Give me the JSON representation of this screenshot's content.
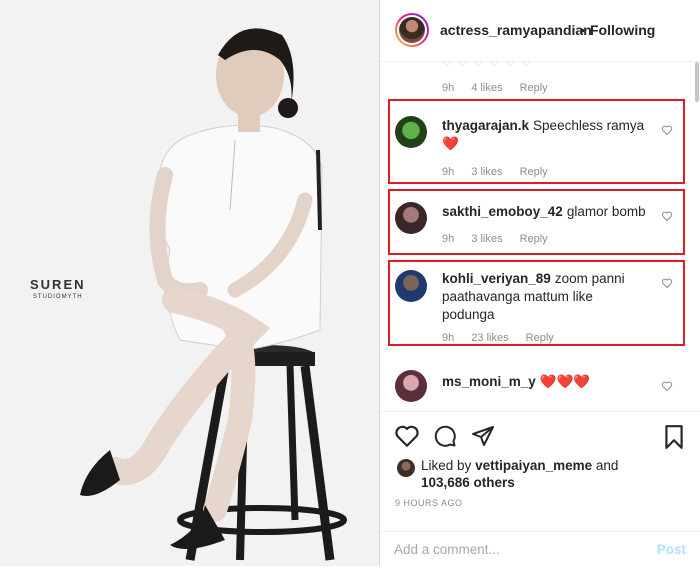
{
  "post": {
    "username": "actress_ramyapandian",
    "separator": "•",
    "follow_status": "Following"
  },
  "photo": {
    "watermark_line1": "SUREN",
    "watermark_line2": "STUDIOMYTH"
  },
  "comments": [
    {
      "user": "",
      "text": "",
      "time": "9h",
      "likes": "4 likes",
      "reply": "Reply",
      "highlighted": false
    },
    {
      "user": "thyagarajan.k",
      "text": "Speechless ramya ❤️",
      "time": "9h",
      "likes": "3 likes",
      "reply": "Reply",
      "highlighted": true
    },
    {
      "user": "sakthi_emoboy_42",
      "text": "glamor bomb",
      "time": "9h",
      "likes": "3 likes",
      "reply": "Reply",
      "highlighted": true
    },
    {
      "user": "kohli_veriyan_89",
      "text": "zoom panni paathavanga mattum like podunga",
      "time": "9h",
      "likes": "23 likes",
      "reply": "Reply",
      "highlighted": true
    },
    {
      "user": "ms_moni_m_y",
      "text": "❤️❤️❤️",
      "time": "",
      "likes": "",
      "reply": "",
      "highlighted": false
    }
  ],
  "actions": {
    "liked_by_prefix": "Liked by",
    "liked_by_user": "vettipaiyan_meme",
    "liked_by_and": "and",
    "others_count": "103,686 others",
    "time_ago": "9 HOURS AGO"
  },
  "add_comment": {
    "placeholder": "Add a comment...",
    "post_label": "Post"
  },
  "colors": {
    "highlight": "#e11b22",
    "heart": "#ed4956",
    "post_disabled": "#b2dffc"
  },
  "icons": [
    "heart-icon",
    "comment-icon",
    "share-icon",
    "bookmark-icon"
  ]
}
